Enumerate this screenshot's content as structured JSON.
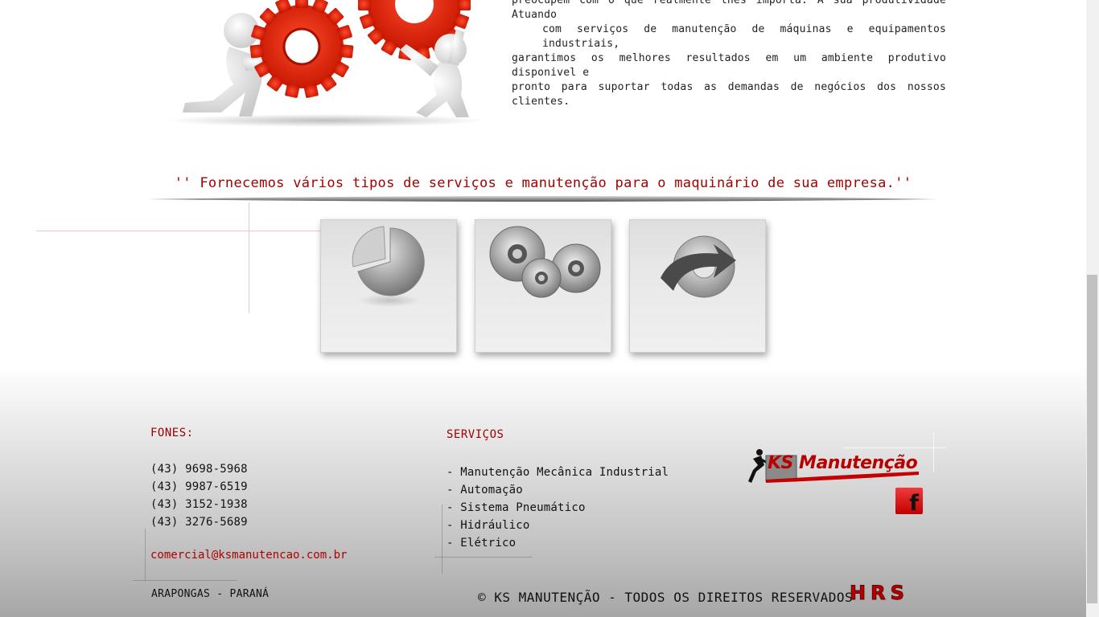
{
  "intro": {
    "line1": "preocupem com o que realmente lhes importa: A sua produtividade Atuando",
    "line2": "com serviços de manutenção de máquinas e equipamentos industriais,",
    "line3": "garantimos os melhores resultados em um ambiente produtivo disponivel e",
    "line4": "pronto para suportar todas as demandas de negócios dos nossos clientes."
  },
  "services_tagline": "'' Fornecemos vários tipos de serviços e manutenção para o maquinário de sua empresa.''",
  "cards": [
    {
      "icon": "pie-chart-icon"
    },
    {
      "icon": "gears-icon"
    },
    {
      "icon": "gear-arrow-icon"
    }
  ],
  "footer": {
    "phones_heading": "FONES:",
    "phones": [
      "(43) 9698-5968",
      "(43) 9987-6519",
      "(43) 3152-1938",
      "(43) 3276-5689"
    ],
    "email": "comercial@ksmanutencao.com.br",
    "city": "ARAPONGAS - PARANÁ",
    "services_heading": "SERVIÇOS",
    "services": [
      "- Manutenção Mecânica Industrial",
      "- Automação",
      "- Sistema Pneumático",
      "- Hidráulico",
      "- Elétrico"
    ],
    "logo_text": "KS Manutenção",
    "facebook_glyph": "f",
    "copyright": "© KS MANUTENÇÃO - TODOS OS DIREITOS RESERVADOS",
    "dev_logo": "HRS"
  },
  "colors": {
    "accent_red": "#a50000",
    "brand_red": "#cc0000"
  }
}
